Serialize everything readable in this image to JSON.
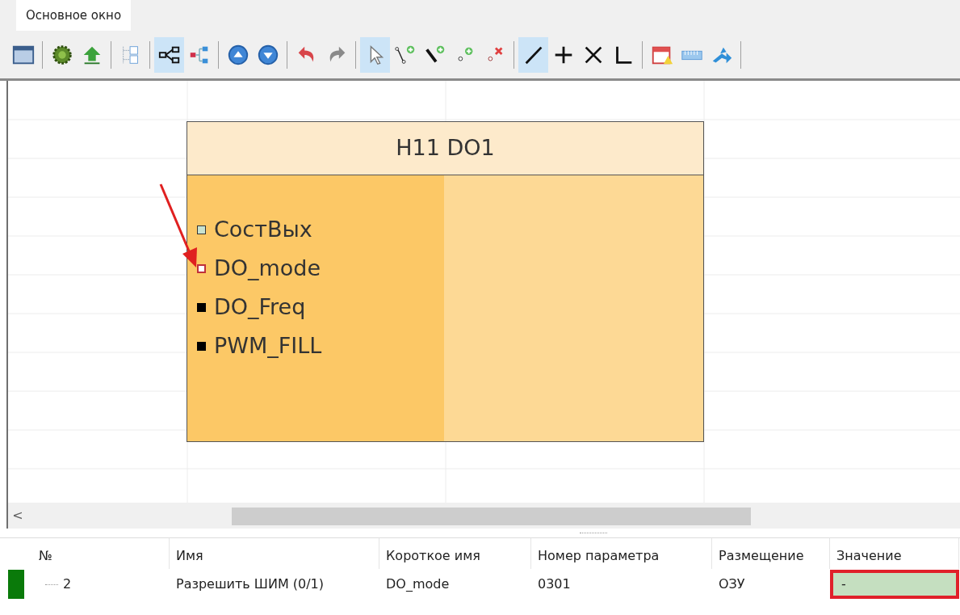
{
  "tabs": [
    {
      "label": "Основное окно",
      "selected": true
    }
  ],
  "toolbar": [
    [
      {
        "kind": "window",
        "selected": false
      }
    ],
    [
      {
        "kind": "gear",
        "selected": false
      },
      {
        "kind": "upload",
        "selected": false
      }
    ],
    [
      {
        "kind": "pages",
        "selected": false
      }
    ],
    [
      {
        "kind": "tree",
        "selected": true
      },
      {
        "kind": "branch",
        "selected": false
      }
    ],
    [
      {
        "kind": "up",
        "selected": false
      },
      {
        "kind": "down",
        "selected": false
      }
    ],
    [
      {
        "kind": "undo",
        "selected": false
      },
      {
        "kind": "redo",
        "selected": false
      }
    ],
    [
      {
        "kind": "pointer",
        "selected": true
      },
      {
        "kind": "curve-add",
        "selected": false
      },
      {
        "kind": "line-add",
        "selected": false
      },
      {
        "kind": "point-add",
        "selected": false
      },
      {
        "kind": "point-remove",
        "selected": false
      }
    ],
    [
      {
        "kind": "slash",
        "selected": true
      },
      {
        "kind": "plus",
        "selected": false
      },
      {
        "kind": "cross",
        "selected": false
      },
      {
        "kind": "corner",
        "selected": false
      }
    ],
    [
      {
        "kind": "calendar",
        "selected": false
      },
      {
        "kind": "ruler",
        "selected": false
      },
      {
        "kind": "share",
        "selected": false
      }
    ]
  ],
  "block": {
    "title": "H11 DO1",
    "ports": [
      {
        "label": "СостВых",
        "kind": "open"
      },
      {
        "label": "DO_mode",
        "kind": "marked"
      },
      {
        "label": "DO_Freq",
        "kind": "filled"
      },
      {
        "label": "PWM_FILL",
        "kind": "filled"
      }
    ]
  },
  "scroll_left": "<",
  "table": {
    "columns": [
      "№",
      "Имя",
      "Короткое имя",
      "Номер параметра",
      "Размещение",
      "Значение"
    ],
    "rows": [
      {
        "number": "2",
        "name": "Разрешить ШИМ (0/1)",
        "short_name": "DO_mode",
        "param": "0301",
        "placement": "ОЗУ",
        "value": "-",
        "value_highlighted": true
      }
    ]
  }
}
